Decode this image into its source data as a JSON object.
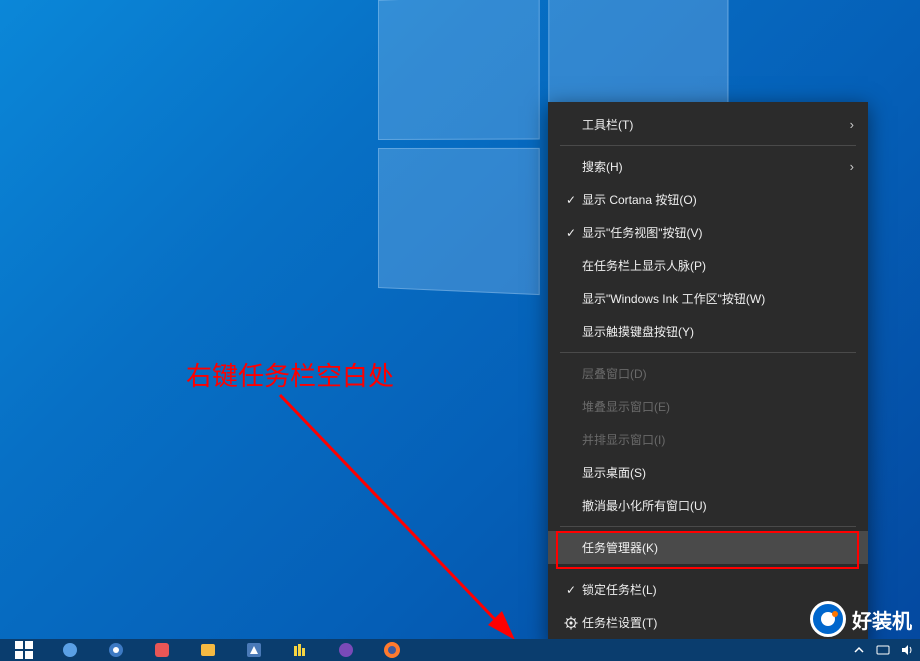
{
  "annotation": "右键任务栏空白处",
  "watermark": "好装机",
  "context_menu": {
    "items": [
      {
        "label": "工具栏(T)",
        "has_submenu": true
      },
      {
        "separator": true
      },
      {
        "label": "搜索(H)",
        "has_submenu": true
      },
      {
        "label": "显示 Cortana 按钮(O)",
        "checked": true
      },
      {
        "label": "显示\"任务视图\"按钮(V)",
        "checked": true
      },
      {
        "label": "在任务栏上显示人脉(P)"
      },
      {
        "label": "显示\"Windows Ink 工作区\"按钮(W)"
      },
      {
        "label": "显示触摸键盘按钮(Y)"
      },
      {
        "separator": true
      },
      {
        "label": "层叠窗口(D)",
        "disabled": true
      },
      {
        "label": "堆叠显示窗口(E)",
        "disabled": true
      },
      {
        "label": "并排显示窗口(I)",
        "disabled": true
      },
      {
        "label": "显示桌面(S)"
      },
      {
        "label": "撤消最小化所有窗口(U)"
      },
      {
        "separator": true
      },
      {
        "label": "任务管理器(K)",
        "highlighted": true
      },
      {
        "separator": true
      },
      {
        "label": "锁定任务栏(L)",
        "checked": true
      },
      {
        "label": "任务栏设置(T)",
        "icon": "gear"
      }
    ]
  },
  "colors": {
    "accent_red": "#ff0000",
    "menu_bg": "#2b2b2b",
    "menu_text": "#f0f0f0"
  }
}
